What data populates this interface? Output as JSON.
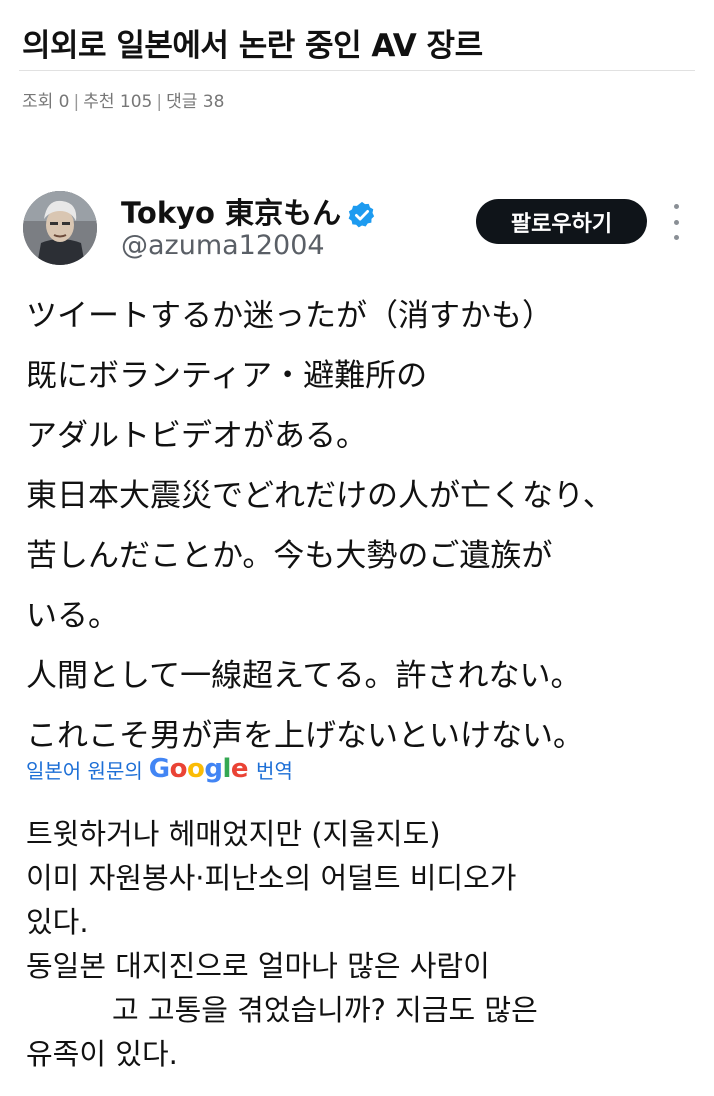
{
  "post": {
    "title": "의외로 일본에서 논란 중인 AV 장르",
    "meta": {
      "views": "조회 0",
      "recommend": "추천 105",
      "comments": "댓글 38"
    }
  },
  "tweet": {
    "author_name": "Tokyo 東京もん",
    "handle": "@azuma12004",
    "follow_label": "팔로우하기",
    "lines": [
      "ツイートするか迷ったが（消すかも）",
      "既にボランティア・避難所の",
      "アダルトビデオがある。",
      "東日本大震災でどれだけの人が亡くなり、",
      "苦しんだことか。今も大勢のご遺族が",
      "いる。",
      "人間として一線超えてる。許されない。",
      "これこそ男が声を上げないといけない。"
    ],
    "translate": {
      "prefix": "일본어 원문의",
      "brand": "Google",
      "suffix": "번역"
    },
    "translation_lines": [
      "트윗하거나 헤매었지만 (지울지도)",
      "이미 자원봉사·피난소의 어덜트 비디오가",
      "있다.",
      "동일본 대지진으로 얼마나 많은 사람이",
      "고 고통을 겪었습니까? 지금도 많은",
      "유족이 있다."
    ]
  },
  "colors": {
    "accent_link": "#1d6fd6",
    "verified": "#1d9bf0",
    "button_bg": "#0f1419"
  },
  "icons": {
    "verified": "verified-badge-icon",
    "more": "more-vertical-icon"
  }
}
